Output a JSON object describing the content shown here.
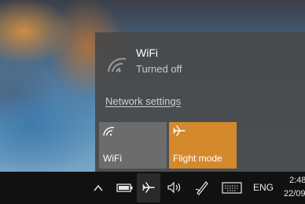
{
  "network_flyout": {
    "wifi_name": "WiFi",
    "wifi_status": "Turned off",
    "network_settings_link": "Network settings",
    "tiles": [
      {
        "label": "WiFi",
        "state": "off",
        "color": "#6c6c6c",
        "icon": "wifi-icon"
      },
      {
        "label": "Flight mode",
        "state": "on",
        "color": "#d4892c",
        "icon": "airplane-icon"
      }
    ]
  },
  "taskbar": {
    "icons": [
      "chevron-up-icon",
      "battery-icon",
      "airplane-icon",
      "volume-icon",
      "pen-icon",
      "keyboard-icon"
    ],
    "language": "ENG",
    "time": "2:48",
    "date": "22/09"
  }
}
